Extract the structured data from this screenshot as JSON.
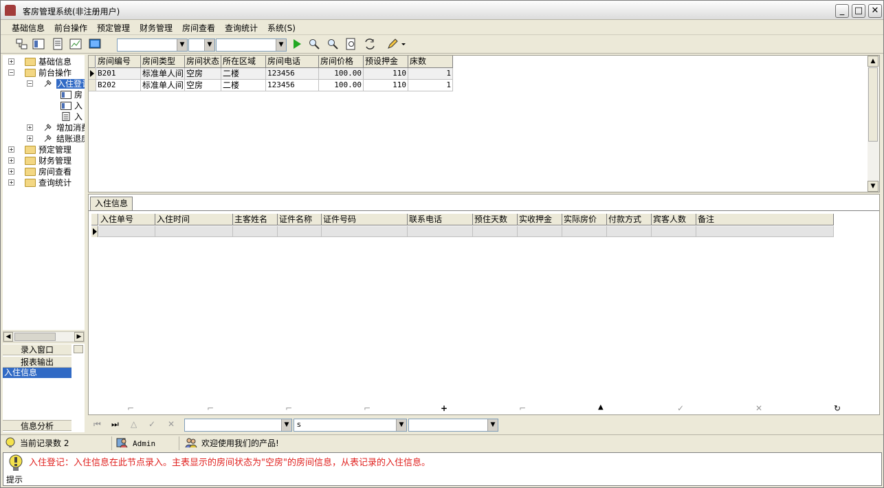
{
  "window": {
    "title": "客房管理系统(非注册用户)"
  },
  "menu": [
    "基础信息",
    "前台操作",
    "预定管理",
    "财务管理",
    "房间查看",
    "查询统计",
    "系统(S)"
  ],
  "tree": {
    "root1": "基础信息",
    "root2": "前台操作",
    "child_checkin": "入住登记",
    "leaf1": "房",
    "leaf2": "入",
    "leaf3": "入",
    "child_add": "增加消费",
    "child_checkout": "结账退房",
    "root3": "预定管理",
    "root4": "财务管理",
    "root5": "房间查看",
    "root6": "查询统计"
  },
  "nav": {
    "btn1": "录入窗口",
    "btn2": "报表输出",
    "selected": "入住信息",
    "btn3": "信息分析"
  },
  "rooms": {
    "columns": [
      "房间编号",
      "房间类型",
      "房间状态",
      "所在区域",
      "房间电话",
      "房间价格",
      "预设押金",
      "床数"
    ],
    "rows": [
      [
        "B201",
        "标准单人间",
        "空房",
        "二楼",
        "123456",
        "100.00",
        "110",
        "1"
      ],
      [
        "B202",
        "标准单人间",
        "空房",
        "二楼",
        "123456",
        "100.00",
        "110",
        "1"
      ]
    ]
  },
  "detail": {
    "tab": "入住信息",
    "columns": [
      "入住单号",
      "入住时间",
      "主客姓名",
      "证件名称",
      "证件号码",
      "联系电话",
      "预住天数",
      "实收押金",
      "实际房价",
      "付款方式",
      "宾客人数",
      "备注"
    ]
  },
  "filter": {
    "value2": "s"
  },
  "status": {
    "records": "当前记录数 2",
    "user": "Admin",
    "welcome": "欢迎使用我们的产品!"
  },
  "hint": {
    "message": "入住登记：入住信息在此节点录入。主表显示的房间状态为\"空房\"的房间信息，从表记录的入住信息。",
    "label": "提示"
  }
}
